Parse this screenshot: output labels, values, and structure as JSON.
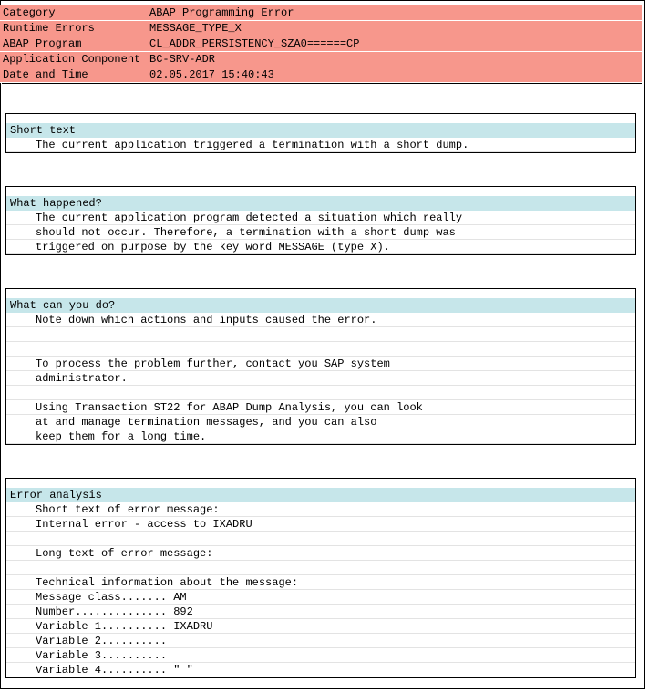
{
  "header": {
    "rows": [
      {
        "key": "Category",
        "value": "ABAP Programming Error"
      },
      {
        "key": "Runtime Errors",
        "value": "MESSAGE_TYPE_X"
      },
      {
        "key": "ABAP Program",
        "value": "CL_ADDR_PERSISTENCY_SZA0======CP"
      },
      {
        "key": "Application Component",
        "value": "BC-SRV-ADR"
      },
      {
        "key": "Date and Time",
        "value": "02.05.2017 15:40:43"
      }
    ]
  },
  "short_text": {
    "title": "Short text",
    "lines": [
      "The current application triggered a termination with a short dump."
    ]
  },
  "what_happened": {
    "title": "What happened?",
    "lines": [
      "The current application program detected a situation which really",
      "should not occur. Therefore, a termination with a short dump was",
      "triggered on purpose by the key word MESSAGE (type X)."
    ]
  },
  "what_can_you_do": {
    "title": "What can you do?",
    "lines": [
      "Note down which actions and inputs caused the error.",
      "",
      "",
      "To process the problem further, contact you SAP system",
      "administrator.",
      "",
      "Using Transaction ST22 for ABAP Dump Analysis, you can look",
      "at and manage termination messages, and you can also",
      "keep them for a long time."
    ]
  },
  "error_analysis": {
    "title": "Error analysis",
    "lines": [
      "Short text of error message:",
      "Internal error - access to IXADRU",
      "",
      "Long text of error message:",
      "",
      "Technical information about the message:",
      "Message class....... AM",
      "Number.............. 892",
      "Variable 1.......... IXADRU",
      "Variable 2..........",
      "Variable 3..........",
      "Variable 4.......... \" \""
    ]
  }
}
